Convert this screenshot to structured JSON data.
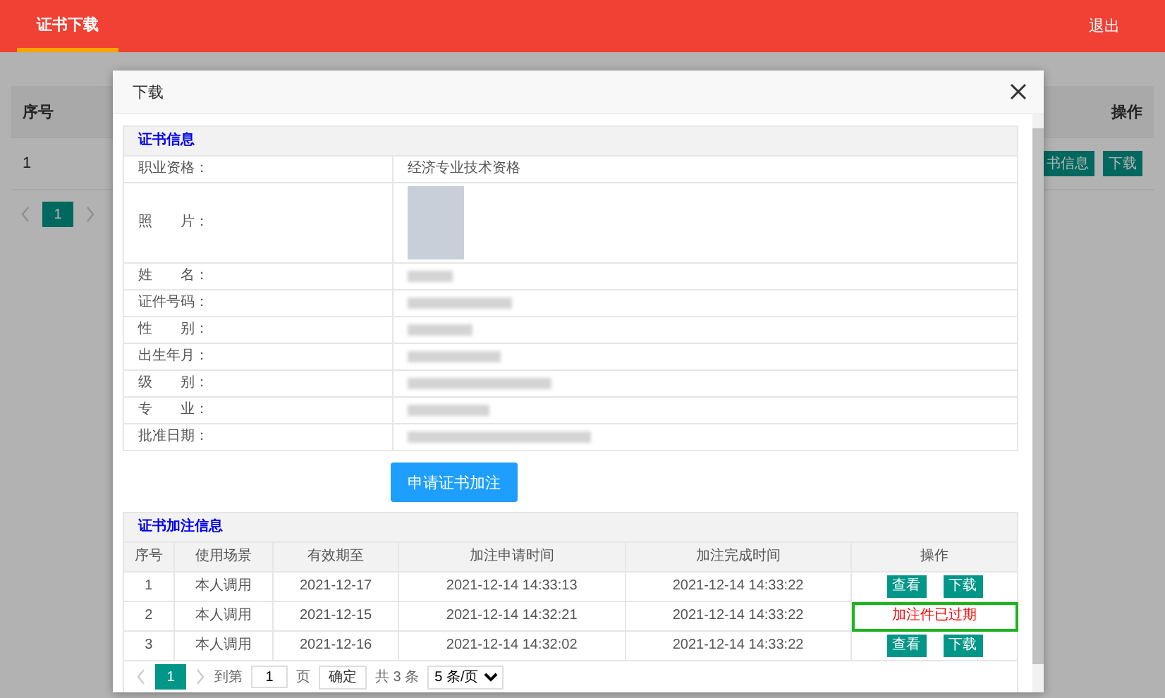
{
  "header": {
    "tabs": [
      {
        "label": "证书下载",
        "selected": true
      }
    ],
    "logout": "退出"
  },
  "background_table": {
    "columns": [
      "序号",
      "操作"
    ],
    "rows": [
      {
        "index": "1",
        "buttons": [
          "书信息",
          "下载"
        ]
      }
    ],
    "pagination": {
      "pages": [
        {
          "label": "1",
          "selected": true
        }
      ]
    }
  },
  "dialog": {
    "title": "下载",
    "info": {
      "title": "证书信息",
      "rows": [
        {
          "label": "职业资格：",
          "kind": "text",
          "value": "经济专业技术资格"
        },
        {
          "label": "照　　片：",
          "kind": "photo"
        },
        {
          "label": "姓　　名：",
          "kind": "blurred"
        },
        {
          "label": "证件号码：",
          "kind": "blurred"
        },
        {
          "label": "性　　别：",
          "kind": "blurred"
        },
        {
          "label": "出生年月：",
          "kind": "blurred"
        },
        {
          "label": "级　　别：",
          "kind": "blurred"
        },
        {
          "label": "专　　业：",
          "kind": "blurred"
        },
        {
          "label": "批准日期：",
          "kind": "blurred"
        }
      ]
    },
    "apply_button": "申请证书加注",
    "annotations": {
      "title": "证书加注信息",
      "columns": [
        "序号",
        "使用场景",
        "有效期至",
        "加注申请时间",
        "加注完成时间",
        "操作"
      ],
      "rows": [
        {
          "cells": [
            "1",
            "本人调用",
            "2021-12-17",
            "2021-12-14 14:33:13",
            "2021-12-14 14:33:22"
          ],
          "kind": "buttons",
          "actions": [
            "查看",
            "下载"
          ],
          "highlighted": false
        },
        {
          "cells": [
            "2",
            "本人调用",
            "2021-12-15",
            "2021-12-14 14:32:21",
            "2021-12-14 14:33:22"
          ],
          "kind": "expired",
          "status": "加注件已过期",
          "highlighted": true
        },
        {
          "cells": [
            "3",
            "本人调用",
            "2021-12-16",
            "2021-12-14 14:32:02",
            "2021-12-14 14:33:22"
          ],
          "kind": "buttons",
          "actions": [
            "查看",
            "下载"
          ],
          "highlighted": false
        }
      ],
      "pagination": {
        "pages": [
          {
            "label": "1",
            "selected": true
          }
        ],
        "goto_label": "到第",
        "page_value": "1",
        "page_unit": "页",
        "confirm": "确定",
        "total": "共 3 条",
        "page_size": "5 条/页"
      }
    }
  }
}
